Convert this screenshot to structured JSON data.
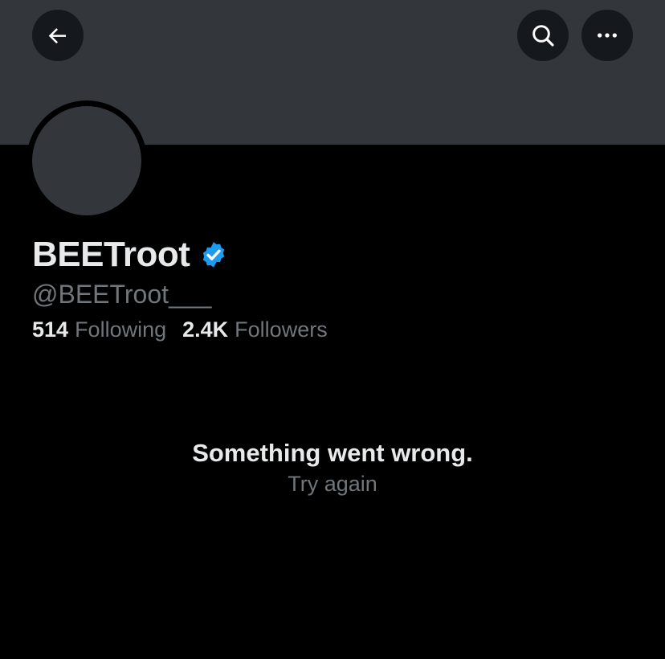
{
  "header": {
    "back_icon": "arrow-left-icon",
    "search_icon": "search-icon",
    "more_icon": "more-horizontal-icon",
    "banner_color": "#33363a"
  },
  "profile": {
    "display_name": "BEETroot",
    "verified_icon": "verified-badge-icon",
    "verified_color": "#1d9bf0",
    "handle": "@BEETroot___",
    "following_count": "514",
    "following_label": "Following",
    "followers_count": "2.4K",
    "followers_label": "Followers"
  },
  "error": {
    "title": "Something went wrong.",
    "retry_label": "Try again"
  }
}
